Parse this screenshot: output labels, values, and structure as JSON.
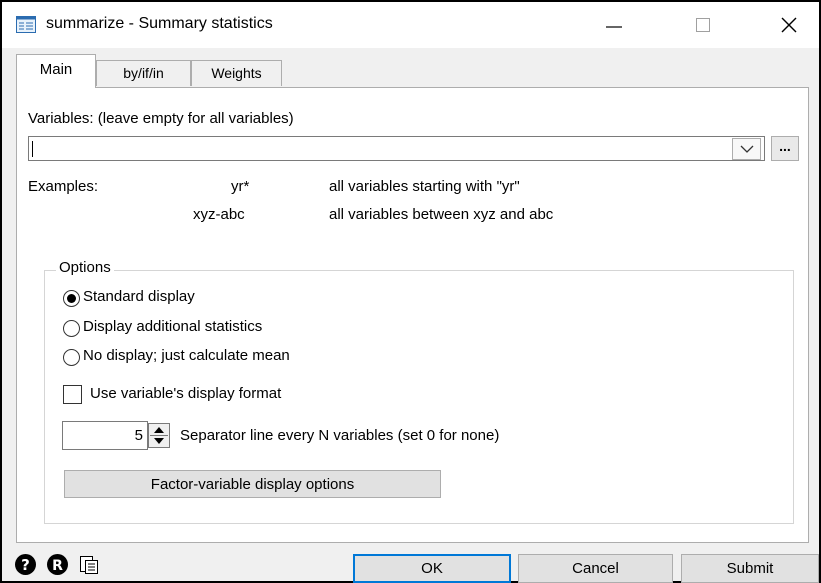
{
  "window": {
    "title": "summarize - Summary statistics",
    "icon": "dialog-app-icon"
  },
  "tabs": [
    {
      "label": "Main",
      "active": true
    },
    {
      "label": "by/if/in",
      "active": false
    },
    {
      "label": "Weights",
      "active": false
    }
  ],
  "variables": {
    "label": "Variables: (leave empty for all variables)",
    "value": "",
    "browse_label": "..."
  },
  "examples": {
    "heading": "Examples:",
    "rows": [
      {
        "pattern": "yr*",
        "description": "all variables starting with \"yr\""
      },
      {
        "pattern": "xyz-abc",
        "description": "all variables between xyz and abc"
      }
    ]
  },
  "options": {
    "legend": "Options",
    "radios": [
      {
        "label": "Standard display",
        "checked": true
      },
      {
        "label": "Display additional statistics",
        "checked": false
      },
      {
        "label": "No display; just calculate mean",
        "checked": false
      }
    ],
    "checkbox": {
      "label": "Use variable's display format",
      "checked": false
    },
    "separator": {
      "value": "5",
      "label": "Separator line every N variables (set 0 for none)"
    },
    "factor_button": "Factor-variable display options"
  },
  "footer": {
    "ok": "OK",
    "cancel": "Cancel",
    "submit": "Submit",
    "icons": [
      "help-icon",
      "reset-icon",
      "copy-command-icon"
    ]
  }
}
